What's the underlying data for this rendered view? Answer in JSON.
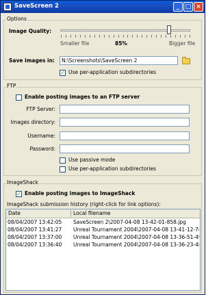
{
  "window": {
    "title": "SaveScreen 2"
  },
  "options": {
    "group_label": "Options",
    "quality_label": "Image Quality:",
    "smaller_label": "Smaller file",
    "quality_value": "85%",
    "bigger_label": "Bigger file",
    "quality_level": 0.85,
    "save_label": "Save images in:",
    "save_path": "N:\\Screenshots\\SaveScreen 2",
    "per_app_label": "Use per-application subdirectories",
    "per_app_checked": true
  },
  "ftp": {
    "group_label": "FTP",
    "enable_label": "Enable posting images to an FTP server",
    "enable_checked": false,
    "server_label": "FTP Server:",
    "dir_label": "Images directory:",
    "user_label": "Username:",
    "pass_label": "Password:",
    "passive_label": "Use passive mode",
    "per_app_label": "Use per-application subdirectories"
  },
  "imageshack": {
    "group_label": "ImageShack",
    "enable_label": "Enable posting images to ImageShack",
    "enable_checked": true,
    "history_label": "ImageShack submission history (right-click for link options):",
    "columns": [
      "Date",
      "Local filename"
    ],
    "rows": [
      {
        "date": "08/04/2007 13:42:05",
        "file": "SaveScreen 2\\2007-04-08 13-42-01-858.jpg"
      },
      {
        "date": "08/04/2007 13:41:27",
        "file": "Unreal Tournament 2004\\2007-04-08 13-41-12-743..."
      },
      {
        "date": "08/04/2007 13:37:00",
        "file": "Unreal Tournament 2004\\2007-04-08 13-36-51-498..."
      },
      {
        "date": "08/04/2007 13:36:40",
        "file": "Unreal Tournament 2004\\2007-04-08 13-36-23-483..."
      }
    ]
  }
}
